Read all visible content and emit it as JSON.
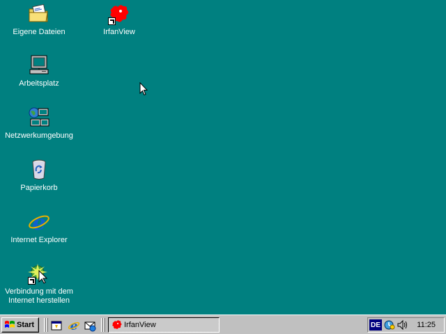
{
  "desktop": {
    "background": "#008080",
    "icons": [
      {
        "label": "Eigene Dateien",
        "icon": "my-documents-icon"
      },
      {
        "label": "IrfanView",
        "icon": "irfanview-icon",
        "shortcut": true
      },
      {
        "label": "Arbeitsplatz",
        "icon": "my-computer-icon"
      },
      {
        "label": "Netzwerkumgebung",
        "icon": "network-neighborhood-icon"
      },
      {
        "label": "Papierkorb",
        "icon": "recycle-bin-icon"
      },
      {
        "label": "Internet Explorer",
        "icon": "internet-explorer-icon"
      },
      {
        "label": "Verbindung mit dem\nInternet herstellen",
        "icon": "connect-to-internet-icon",
        "shortcut": true
      }
    ]
  },
  "taskbar": {
    "start_label": "Start",
    "quick_launch": [
      "show-desktop-icon",
      "internet-explorer-icon",
      "outlook-express-icon"
    ],
    "tasks": [
      {
        "label": "IrfanView",
        "icon": "irfanview-icon"
      }
    ],
    "tray": {
      "language": "DE",
      "icons": [
        "scheduler-icon",
        "volume-icon"
      ],
      "clock": "11:25"
    }
  }
}
